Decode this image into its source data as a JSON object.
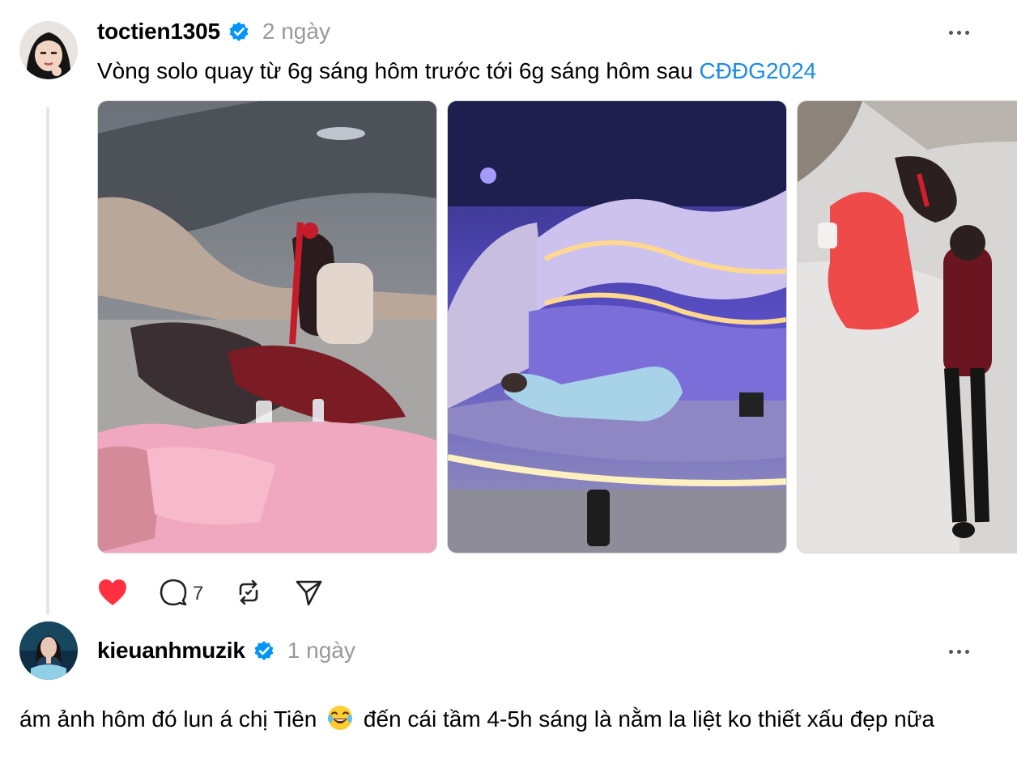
{
  "post": {
    "username": "toctien1305",
    "time": "2 ngày",
    "text": "Vòng solo quay từ 6g sáng hôm trước tới 6g sáng hôm sau ",
    "hashtag": "CĐĐG2024",
    "images": [
      "photo-1",
      "photo-2",
      "photo-3"
    ],
    "actions": {
      "liked": true,
      "comment_count": "7"
    },
    "icons": [
      "heart-icon",
      "comment-icon",
      "repost-icon",
      "share-icon",
      "more-icon",
      "verified-icon"
    ]
  },
  "reply": {
    "username": "kieuanhmuzik",
    "time": "1 ngày",
    "text_before_emoji": "ám ảnh hôm đó lun á chị Tiên",
    "emoji": "😂",
    "text_after_emoji": " đến cái tầm 4-5h sáng là nằm la liệt ko thiết xấu đẹp nữa"
  },
  "colors": {
    "hashtag": "#1c8be6",
    "verified": "#0095f6",
    "like": "#ff3040",
    "muted": "#999999"
  }
}
